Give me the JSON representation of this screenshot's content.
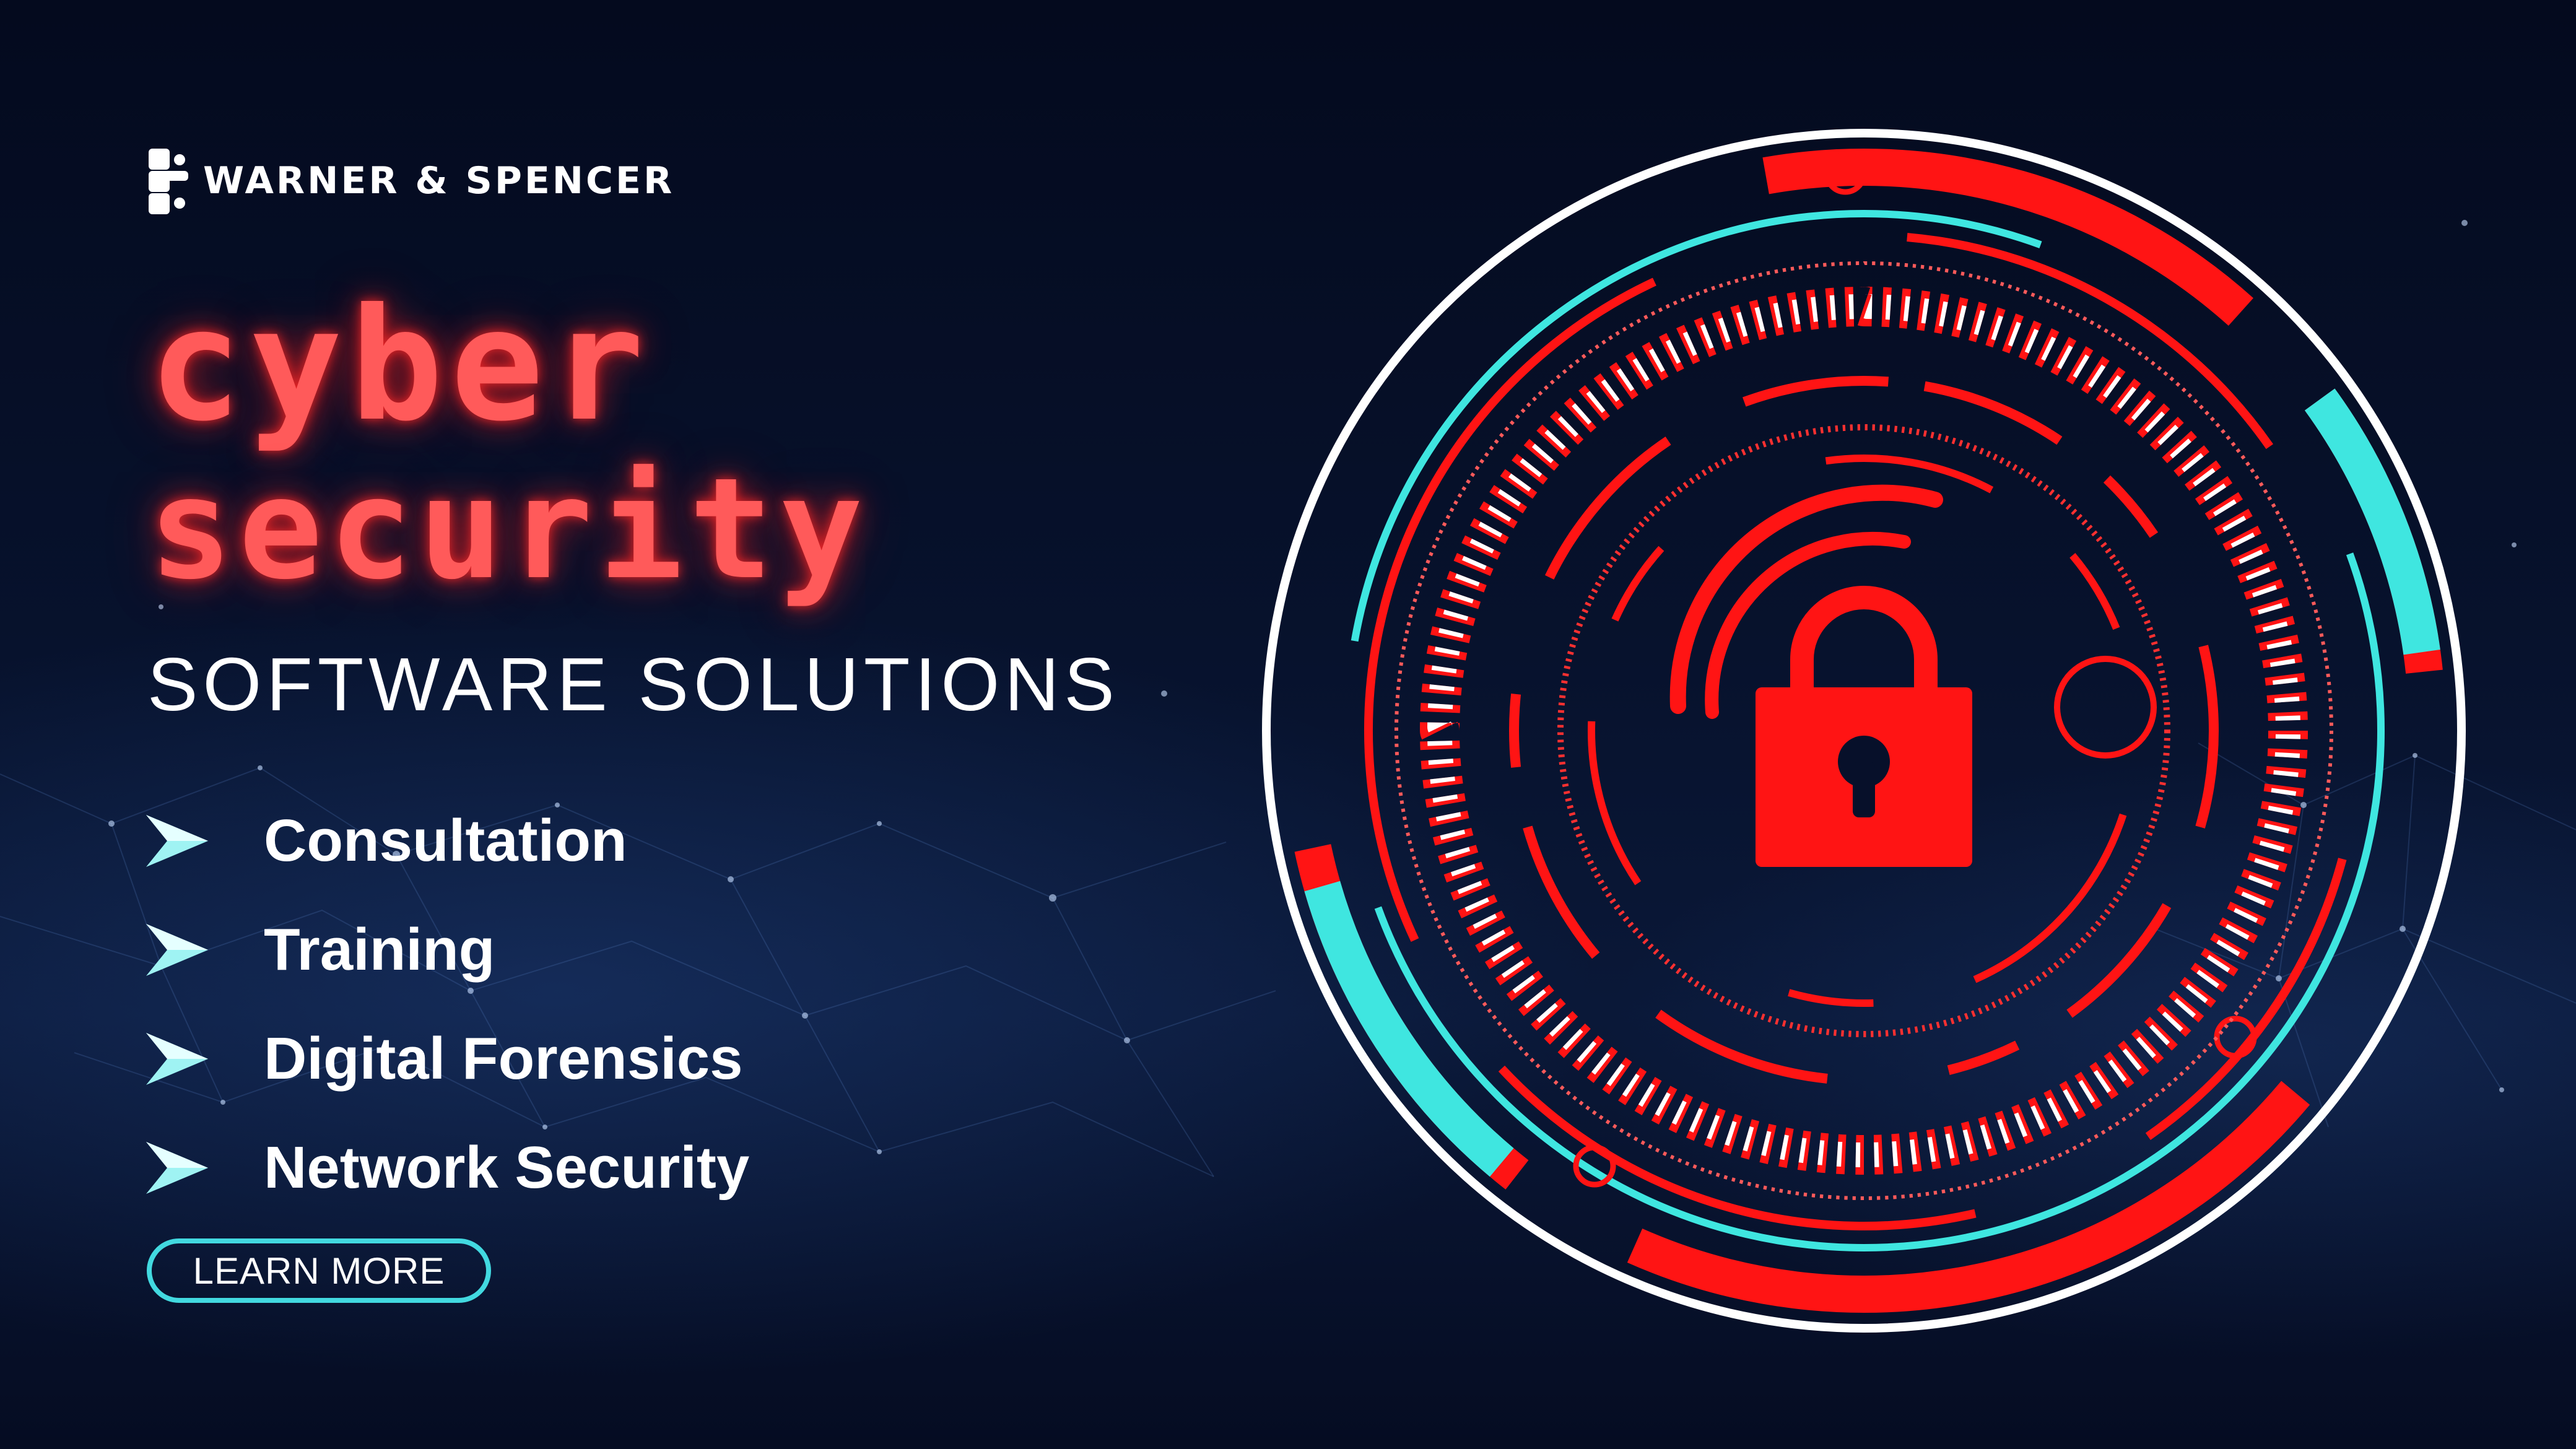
{
  "brand": {
    "name": "WARNER & SPENCER",
    "logo_icon": "puzzle-network-icon"
  },
  "headline": {
    "line1": "cyber",
    "line2": "security"
  },
  "subtitle": "SOFTWARE SOLUTIONS",
  "services": [
    {
      "label": "Consultation",
      "icon": "arrow-right-icon"
    },
    {
      "label": "Training",
      "icon": "arrow-right-icon"
    },
    {
      "label": "Digital Forensics",
      "icon": "arrow-right-icon"
    },
    {
      "label": "Network Security",
      "icon": "arrow-right-icon"
    }
  ],
  "cta": {
    "label": "LEARN MORE"
  },
  "emblem": {
    "icon": "padlock-icon",
    "signal_icon": "wireless-signal-icon"
  },
  "colors": {
    "background": "#07102a",
    "accent_red": "#ff1a1a",
    "headline_red": "#ff5a5a",
    "accent_cyan": "#3fe6e0",
    "text": "#ffffff"
  }
}
